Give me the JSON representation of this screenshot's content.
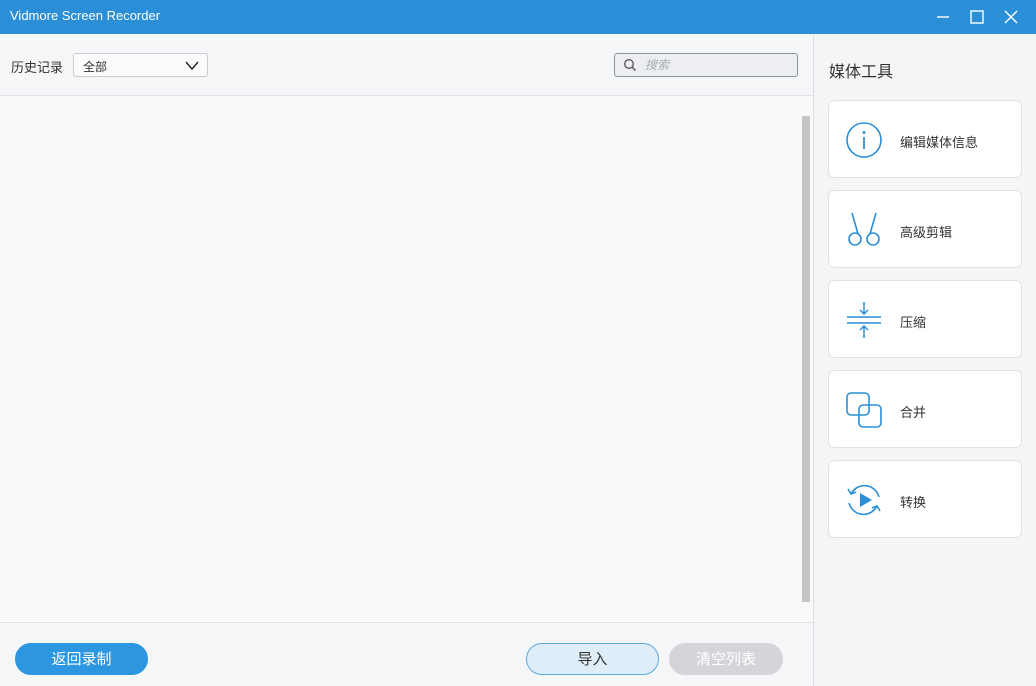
{
  "window": {
    "title": "Vidmore Screen Recorder",
    "controls": [
      "minimize-icon",
      "maximize-icon",
      "close-icon"
    ]
  },
  "history": {
    "label": "历史记录",
    "filter_value": "全部",
    "search_placeholder": "搜索",
    "search_value": ""
  },
  "footer": {
    "back_label": "返回录制",
    "import_label": "导入",
    "clear_label": "清空列表"
  },
  "media_tools": {
    "title": "媒体工具",
    "items": [
      {
        "label": "编辑媒体信息",
        "icon": "info-icon"
      },
      {
        "label": "高级剪辑",
        "icon": "scissors-icon"
      },
      {
        "label": "压缩",
        "icon": "compress-icon"
      },
      {
        "label": "合并",
        "icon": "merge-icon"
      },
      {
        "label": "转换",
        "icon": "convert-icon"
      }
    ]
  },
  "colors": {
    "accent": "#2a8fd6",
    "button_primary": "#2c97e0",
    "button_disabled": "#d4d5d8"
  }
}
